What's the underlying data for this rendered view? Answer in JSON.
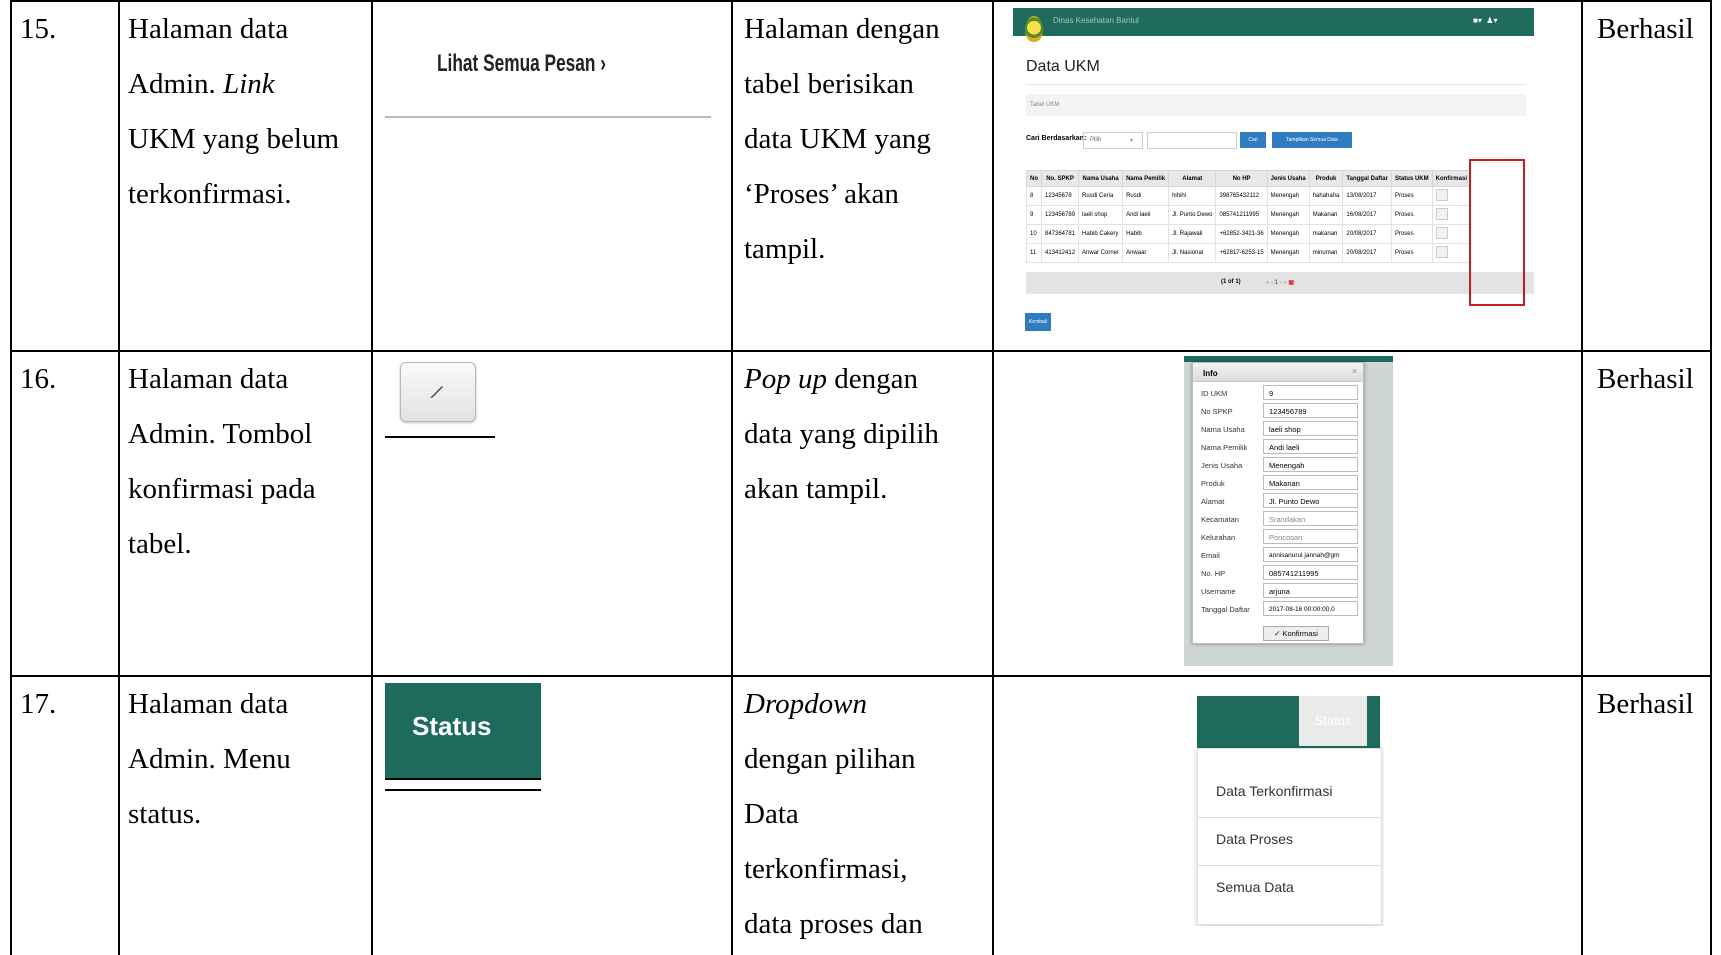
{
  "rows": [
    {
      "no": "15.",
      "scenario": [
        "Halaman data",
        "Admin. Link",
        "UKM yang belum",
        "terkonfirmasi."
      ],
      "scenario_italic_word": "Link",
      "test_label": "Lihat Semua Pesan ›",
      "expected": [
        "Halaman dengan",
        "tabel berisikan",
        "data UKM yang",
        "‘Proses’ akan",
        "tampil."
      ],
      "result": "Berhasil"
    },
    {
      "no": "16.",
      "scenario": [
        "Halaman data",
        "Admin. Tombol",
        "konfirmasi pada",
        "tabel."
      ],
      "expected": [
        "Pop up dengan",
        "data yang dipilih",
        "akan tampil."
      ],
      "expected_italic": "Pop up",
      "result": "Berhasil"
    },
    {
      "no": "17.",
      "scenario": [
        "Halaman data",
        "Admin. Menu",
        "status."
      ],
      "test_label": "Status",
      "expected": [
        "Dropdown",
        "dengan pilihan",
        "Data",
        "terkonfirmasi,",
        "data proses dan"
      ],
      "expected_italic": "Dropdown",
      "result": "Berhasil"
    }
  ],
  "ukm_screen": {
    "brand": "Dinas Kesehatan Bantul",
    "title": "Data UKM",
    "breadcrumb": "Tabel UKM",
    "search_label": "Cari Berdasarkan:",
    "search_select": "Pilih",
    "btn_cari": "Cari",
    "btn_all": "Tampilkan Semua Data",
    "columns": [
      "No",
      "No. SPKP",
      "Nama Usaha",
      "Nama Pemilik",
      "Alamat",
      "No HP",
      "Jenis Usaha",
      "Produk",
      "Tanggal Daftar",
      "Status UKM",
      "Konfirmasi"
    ],
    "rows": [
      [
        "8",
        "12345678",
        "Rusdi Ceria",
        "Rusdi",
        "hihihi",
        "398765432112",
        "Menengah",
        "hahahaha",
        "13/08/2017",
        "Proses"
      ],
      [
        "9",
        "123456789",
        "laeli shop",
        "Andi laeli",
        "Jl. Punto Dewo",
        "085741211995",
        "Menengah",
        "Makanan",
        "16/08/2017",
        "Proses"
      ],
      [
        "10",
        "847364781",
        "Habib Cakery",
        "Habib",
        "Jl. Rajawali",
        "+62852-3421-36",
        "Menengah",
        "makanan",
        "20/08/2017",
        "Proses"
      ],
      [
        "11",
        "413412412",
        "Anwar Corner",
        "Anwaar",
        "Jl. Nasional",
        "+62817-6253-15",
        "Menengah",
        "minuman",
        "20/08/2017",
        "Proses"
      ]
    ],
    "pager": "(1 of 1)",
    "btn_back": "Kembali"
  },
  "popup": {
    "title": "Info",
    "fields": [
      {
        "k": "ID UKM",
        "v": "9"
      },
      {
        "k": "No SPKP",
        "v": "123456789"
      },
      {
        "k": "Nama Usaha",
        "v": "laeli shop"
      },
      {
        "k": "Nama Pemilik",
        "v": "Andi laeli"
      },
      {
        "k": "Jenis Usaha",
        "v": "Menengah"
      },
      {
        "k": "Produk",
        "v": "Makanan"
      },
      {
        "k": "Alamat",
        "v": "Jl. Punto Dewo"
      },
      {
        "k": "Kecamatan",
        "v": "Srandakan"
      },
      {
        "k": "Kelurahan",
        "v": "Poncosari"
      },
      {
        "k": "Email",
        "v": "annisanurul jannah@gm"
      },
      {
        "k": "No. HP",
        "v": "085741211995"
      },
      {
        "k": "Username",
        "v": "arjuna"
      },
      {
        "k": "Tanggal Daftar",
        "v": "2017-08-16 00:00:00.0"
      }
    ],
    "confirm": "✓ Konfirmasi"
  },
  "status_menu": {
    "header": "Status",
    "items": [
      "Data Terkonfirmasi",
      "Data Proses",
      "Semua Data"
    ]
  }
}
